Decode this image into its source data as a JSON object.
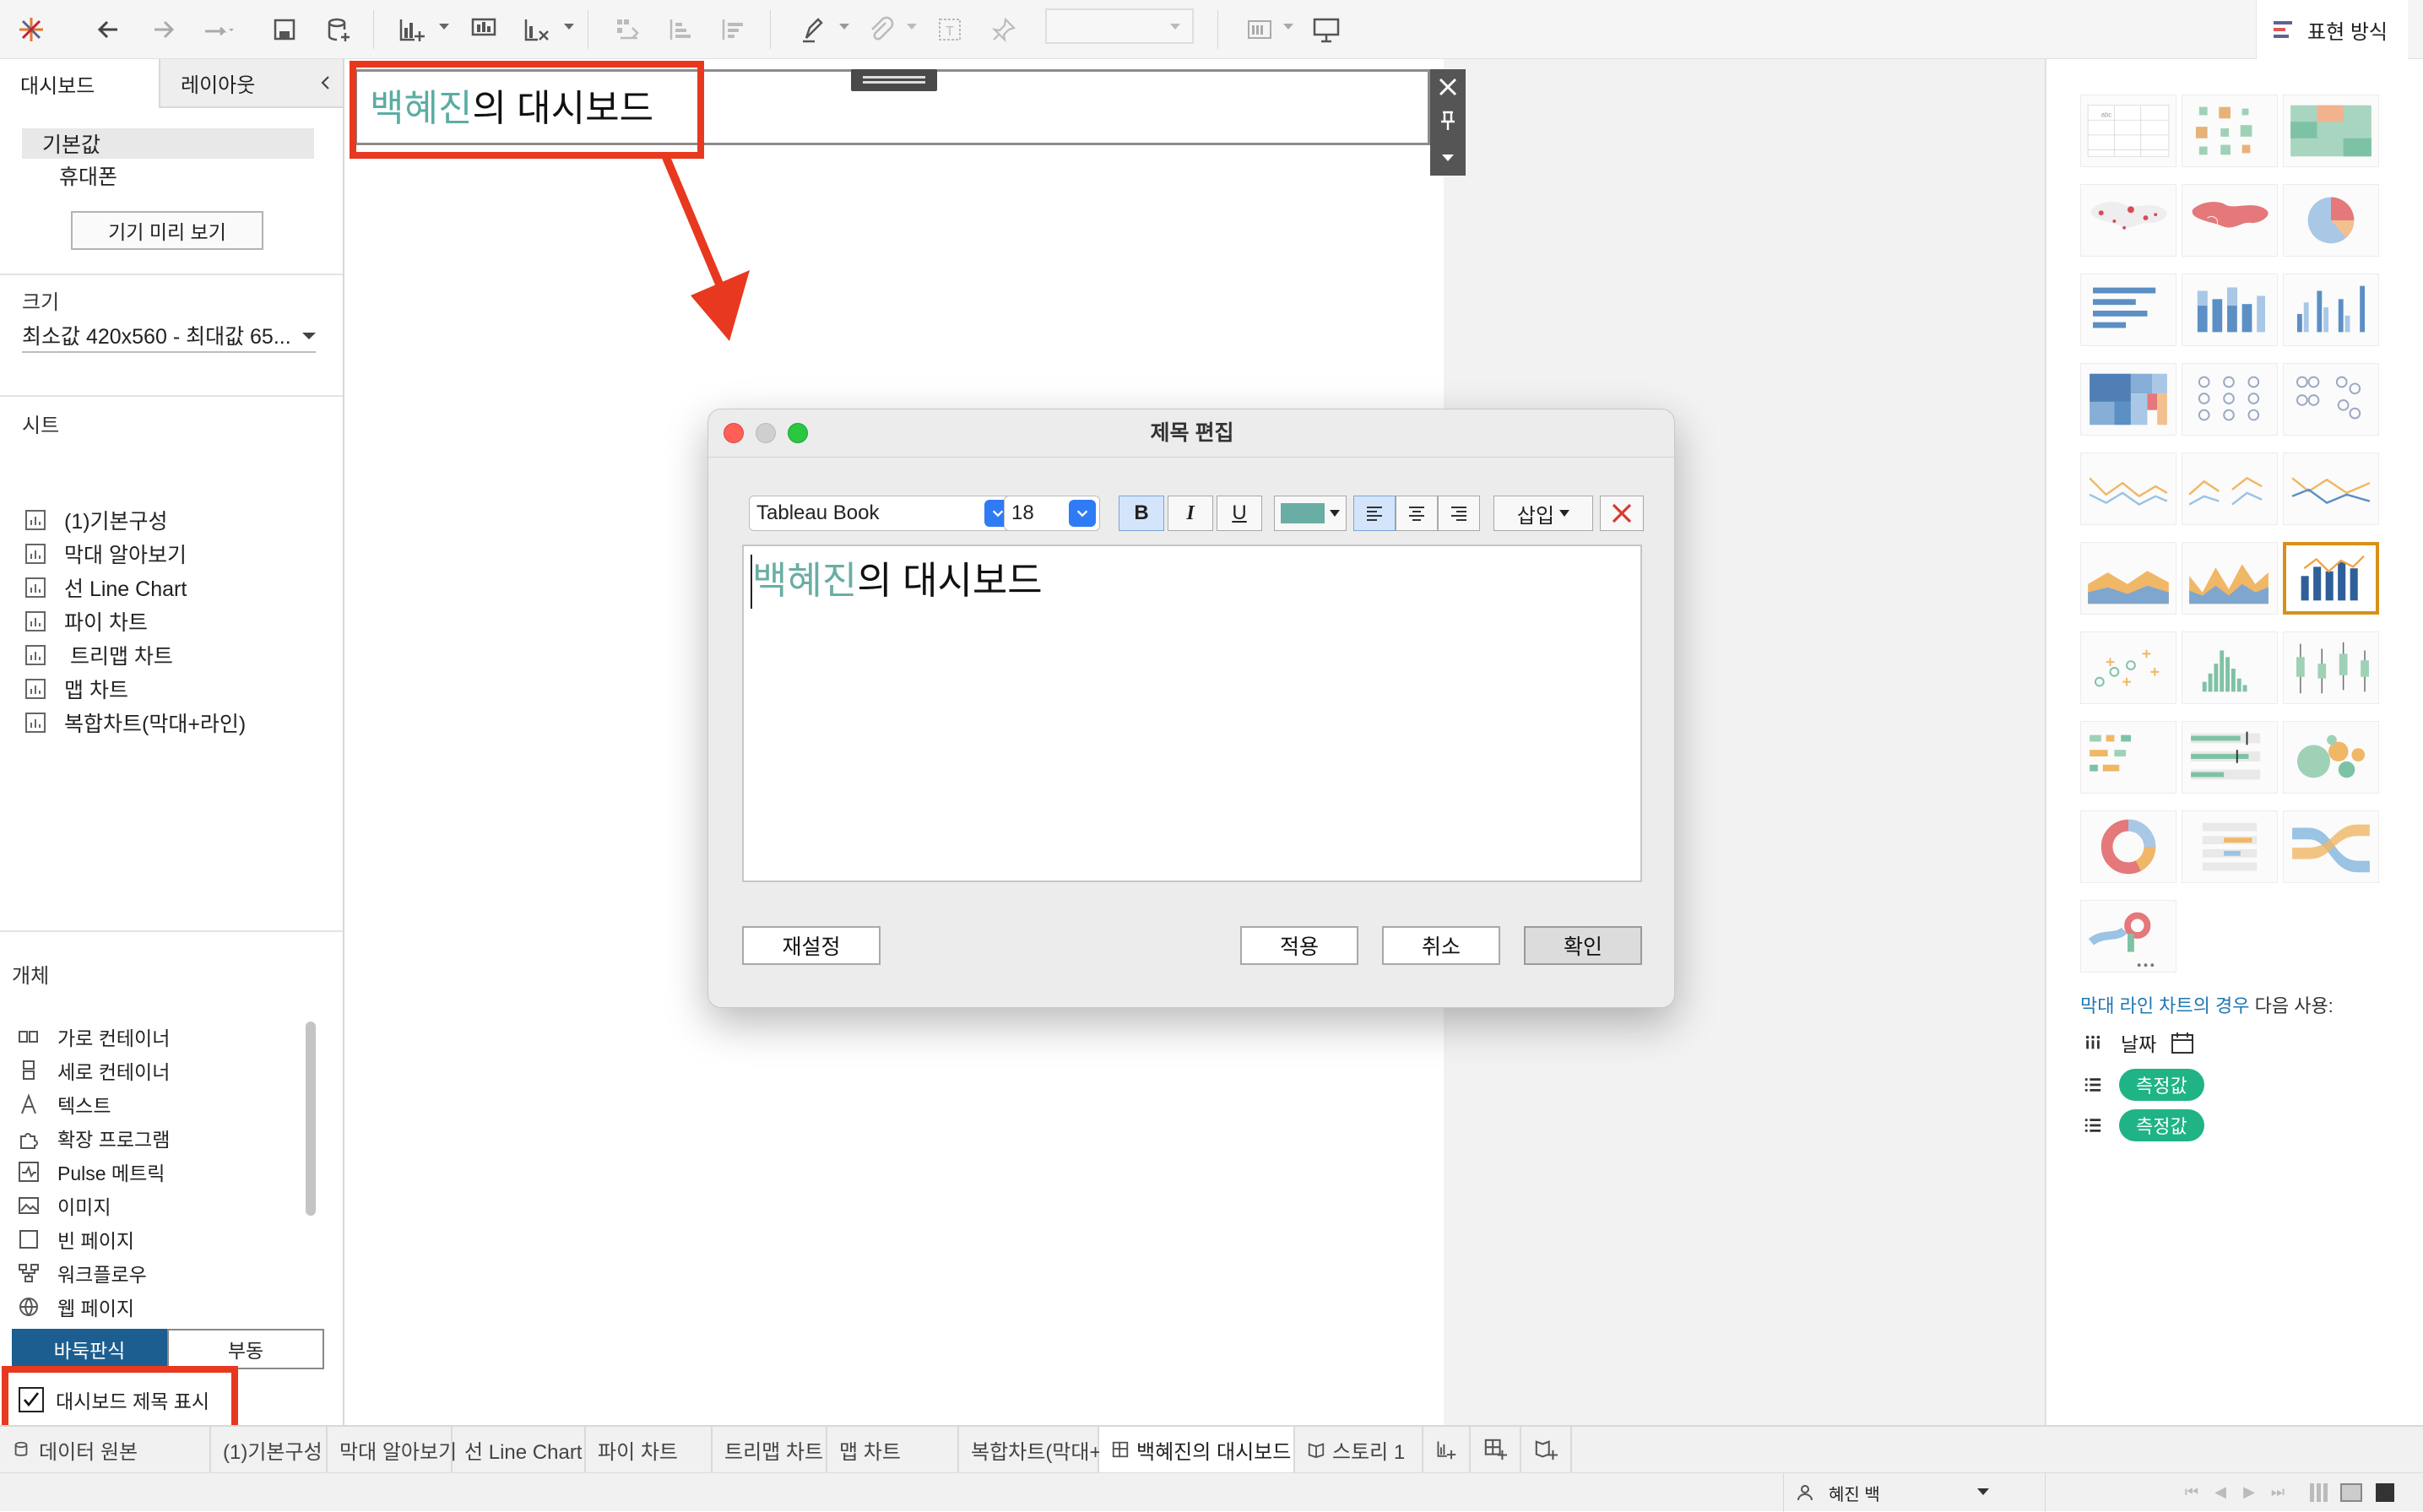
{
  "toolbar": {
    "icons": [
      "tableau-logo-icon",
      "undo-icon",
      "redo-icon",
      "replay-icon",
      "save-icon",
      "new-datasource-icon",
      "new-worksheet-icon",
      "new-dashboard-icon",
      "clear-sheet-icon",
      "swap-icon",
      "sort-ascending-icon",
      "sort-descending-icon",
      "highlight-icon",
      "annotate-icon",
      "label-icon",
      "pin-icon",
      "fit-dropdown",
      "show-cards-icon",
      "presentation-icon"
    ],
    "showme_label": "표현 방식"
  },
  "left_panel": {
    "tabs": [
      "대시보드",
      "레이아웃"
    ],
    "device": {
      "default": "기본값",
      "phone": "휴대폰",
      "preview_button": "기기 미리 보기"
    },
    "size": {
      "title": "크기",
      "value": "최소값 420x560 - 최대값 65..."
    },
    "sheets": {
      "title": "시트",
      "items": [
        "(1)기본구성",
        "막대 알아보기",
        "선 Line Chart",
        "파이 차트",
        " 트리맵 차트",
        "맵 차트",
        "복합차트(막대+라인)"
      ]
    },
    "objects": {
      "title": "개체",
      "items": [
        "가로 컨테이너",
        "세로 컨테이너",
        "텍스트",
        "확장 프로그램",
        "Pulse 메트릭",
        "이미지",
        "빈 페이지",
        "워크플로우",
        "웹 페이지"
      ]
    },
    "layout_toggle": [
      "바둑판식",
      "부동"
    ],
    "show_title": {
      "label": "대시보드 제목 표시",
      "checked": true
    }
  },
  "dashboard_title": {
    "name_part": "백혜진",
    "rest": "의 대시보드",
    "accent_color": "#5aada2"
  },
  "dialog": {
    "title": "제목 편집",
    "font": "Tableau Book",
    "size": "18",
    "bold": "B",
    "italic": "I",
    "underline": "U",
    "color": "#6aada4",
    "insert": "삽입",
    "text_name": "백혜진",
    "text_rest": "의 대시보드",
    "buttons": {
      "reset": "재설정",
      "apply": "적용",
      "cancel": "취소",
      "ok": "확인"
    }
  },
  "showme": {
    "hint_link": "막대 라인 차트의 경우",
    "hint_rest": " 다음 사용:",
    "fields": [
      {
        "icon": "dimension-icon",
        "label": "날짜"
      },
      {
        "icon": "measure-list-icon",
        "label": "측정값"
      },
      {
        "icon": "measure-list-icon",
        "label": "측정값"
      }
    ]
  },
  "bottom_tabs": {
    "datasource": "데이터 원본",
    "tabs": [
      "(1)기본구성",
      "막대 알아보기",
      "선 Line Chart",
      "파이 차트",
      "트리맵 차트",
      "맵 차트",
      "복합차트(막대+라인)",
      "백혜진의 대시보드",
      "스토리 1"
    ],
    "active_index": 7
  },
  "status": {
    "user": "혜진 백"
  }
}
